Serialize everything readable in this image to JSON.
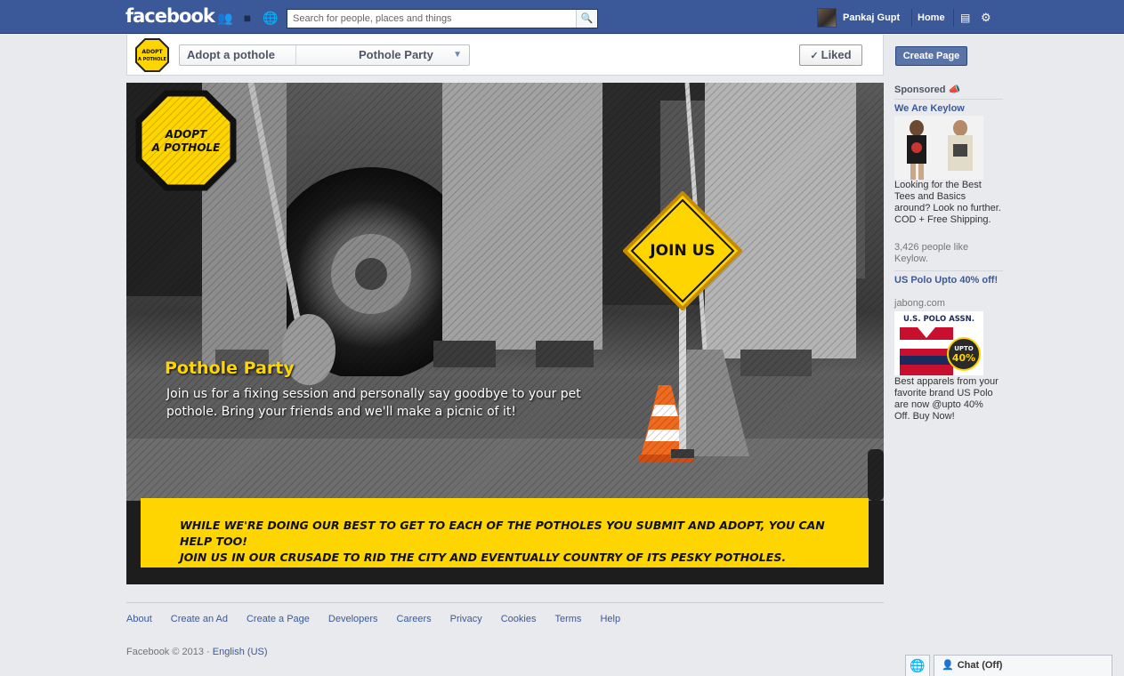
{
  "topbar": {
    "logo": "facebook",
    "search_placeholder": "Search for people, places and things",
    "user_name": "Pankaj Gupt",
    "home_label": "Home"
  },
  "page_header": {
    "page_name": "Adopt a pothole",
    "app_name": "Pothole Party",
    "liked_label": "Liked"
  },
  "banner": {
    "logo_line1": "ADOPT",
    "logo_line2": "A POTHOLE",
    "sign_text": "JOIN US",
    "title": "Pothole Party",
    "description": "Join us for a fixing session and personally say goodbye to your pet pothole. Bring your friends and we'll make a picnic of it!",
    "strip_line1": "While we're doing our best to get to each of the potholes you submit and adopt, you can help too!",
    "strip_line2": "Join us in our crusade to rid the city and eventually country of its pesky potholes."
  },
  "right_column": {
    "create_page_label": "Create Page",
    "sponsored_label": "Sponsored",
    "ads": [
      {
        "title": "We Are Keylow",
        "body": "Looking for the Best Tees and Basics around? Look no further. COD + Free Shipping.",
        "meta": "3,426 people like Keylow."
      },
      {
        "title": "US Polo Upto 40% off!",
        "domain": "jabong.com",
        "image_brand": "U.S. POLO ASSN.",
        "badge_line1": "UPTO",
        "badge_line2": "40%",
        "body": "Best apparels from your favorite brand US Polo are now @upto 40% Off. Buy Now!"
      }
    ]
  },
  "footer": {
    "links": [
      "About",
      "Create an Ad",
      "Create a Page",
      "Developers",
      "Careers",
      "Privacy",
      "Cookies",
      "Terms",
      "Help"
    ],
    "copyright": "Facebook © 2013 · ",
    "language": "English (US)"
  },
  "chat": {
    "label": "Chat (Off)"
  }
}
